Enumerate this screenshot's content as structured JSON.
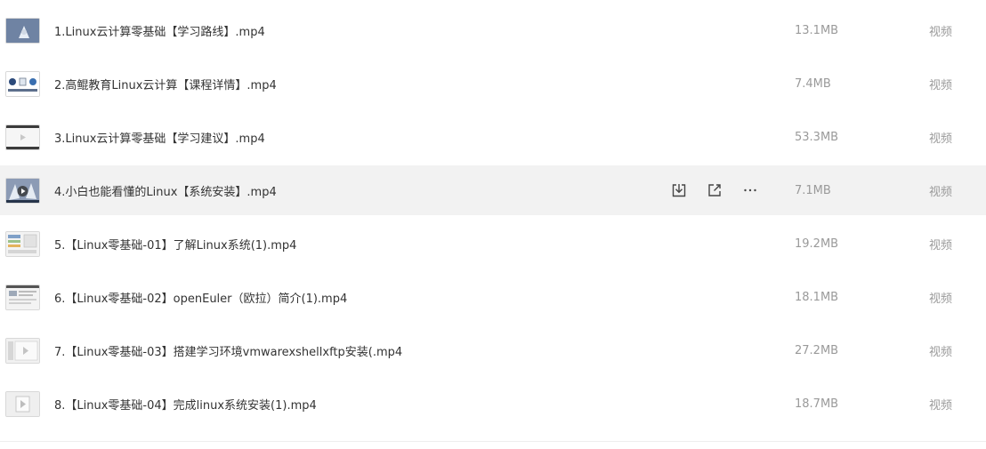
{
  "files": [
    {
      "name": "1.Linux云计算零基础【学习路线】.mp4",
      "size": "13.1MB",
      "type": "视频",
      "thumb_icon": "video-thumbnail-icon"
    },
    {
      "name": "2.高鲲教育Linux云计算【课程详情】.mp4",
      "size": "7.4MB",
      "type": "视频",
      "thumb_icon": "video-thumbnail-icon"
    },
    {
      "name": "3.Linux云计算零基础【学习建议】.mp4",
      "size": "53.3MB",
      "type": "视频",
      "thumb_icon": "video-thumbnail-icon"
    },
    {
      "name": "4.小白也能看懂的Linux【系统安装】.mp4",
      "size": "7.1MB",
      "type": "视频",
      "thumb_icon": "video-thumbnail-icon"
    },
    {
      "name": "5.【Linux零基础-01】了解Linux系统(1).mp4",
      "size": "19.2MB",
      "type": "视频",
      "thumb_icon": "video-thumbnail-icon"
    },
    {
      "name": "6.【Linux零基础-02】openEuler（欧拉）简介(1).mp4",
      "size": "18.1MB",
      "type": "视频",
      "thumb_icon": "video-thumbnail-icon"
    },
    {
      "name": "7.【Linux零基础-03】搭建学习环境vmwarexshellxftp安装(.mp4",
      "size": "27.2MB",
      "type": "视频",
      "thumb_icon": "video-thumbnail-icon"
    },
    {
      "name": "8.【Linux零基础-04】完成linux系统安装(1).mp4",
      "size": "18.7MB",
      "type": "视频",
      "thumb_icon": "video-thumbnail-icon"
    }
  ],
  "hover_row_actions": [
    "download-icon",
    "share-icon",
    "more-icon"
  ],
  "colors": {
    "hover_bg": "#f2f2f2",
    "name_text": "#333333",
    "meta_text": "#9a9a9a"
  }
}
